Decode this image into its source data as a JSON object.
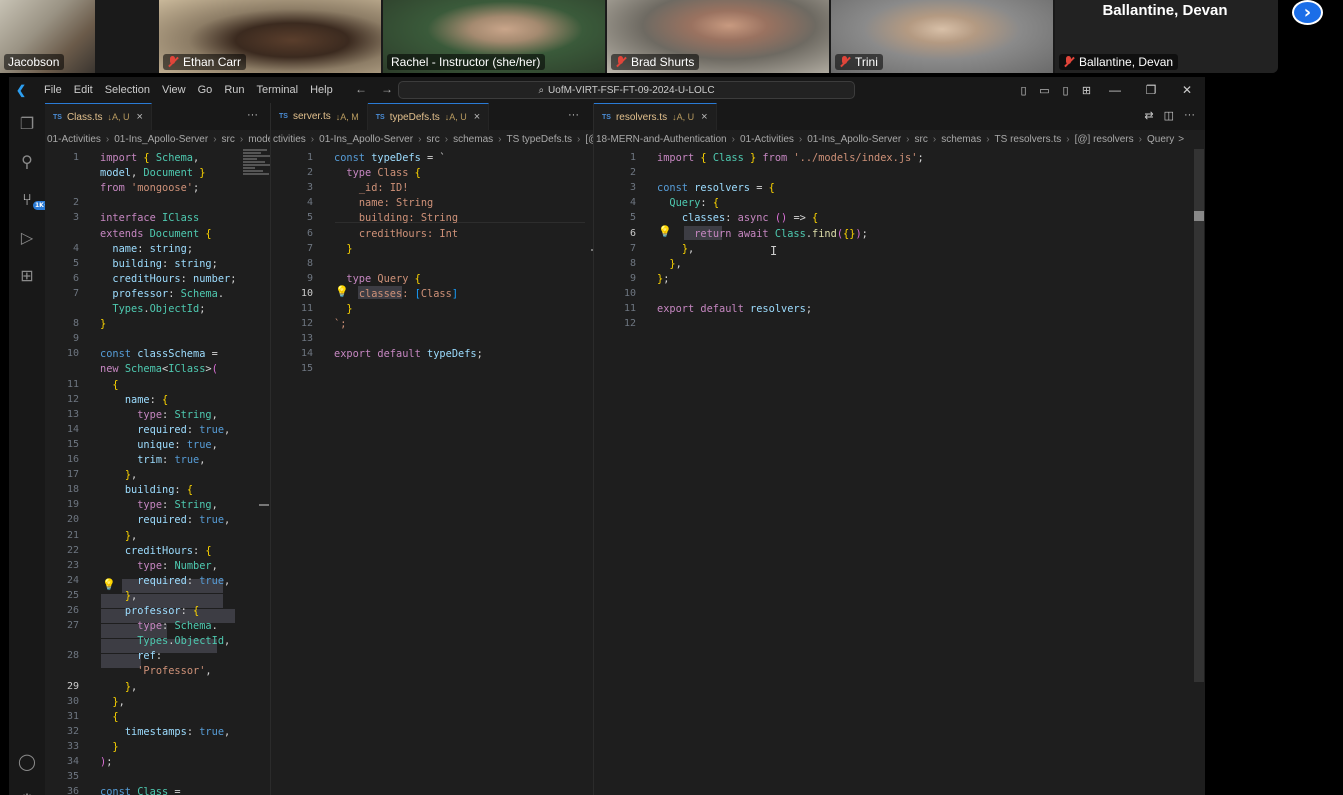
{
  "meeting": {
    "participants": [
      {
        "name": "Jacobson",
        "muted": false
      },
      {
        "name": "Ethan Carr",
        "muted": true
      },
      {
        "name": "Rachel - Instructor (she/her)",
        "muted": false,
        "speaking": true
      },
      {
        "name": "Brad Shurts",
        "muted": true
      },
      {
        "name": "Trini",
        "muted": true
      },
      {
        "name": "Ballantine, Devan",
        "muted": true
      }
    ],
    "featured_name": "Ballantine, Devan",
    "next_icon": "chevron-right-icon"
  },
  "vscode": {
    "menu": [
      "File",
      "Edit",
      "Selection",
      "View",
      "Go",
      "Run",
      "Terminal",
      "Help"
    ],
    "command_center": "UofM-VIRT-FSF-FT-09-2024-U-LOLC",
    "activity_badge": "1K+",
    "groups": [
      {
        "tabs": [
          {
            "lang": "TS",
            "name": "Class.ts",
            "status": "↓A, U",
            "active": true,
            "close": "×"
          }
        ],
        "breadcrumbs": [
          "01-Activities",
          "01-Ins_Apollo-Server",
          "src",
          "models"
        ]
      },
      {
        "tabs": [
          {
            "lang": "TS",
            "name": "server.ts",
            "status": "↓A, M",
            "active": false
          },
          {
            "lang": "TS",
            "name": "typeDefs.ts",
            "status": "↓A, U",
            "active": true,
            "close": "×"
          }
        ],
        "breadcrumbs": [
          "ctivities",
          "01-Ins_Apollo-Server",
          "src",
          "schemas",
          "TS typeDefs.ts",
          "[@]"
        ]
      },
      {
        "tabs": [
          {
            "lang": "TS",
            "name": "resolvers.ts",
            "status": "↓A, U",
            "active": true,
            "close": "×"
          }
        ],
        "breadcrumbs": [
          "18-MERN-and-Authentication",
          "01-Activities",
          "01-Ins_Apollo-Server",
          "src",
          "schemas",
          "TS resolvers.ts",
          "[@] resolvers",
          "Query",
          ">"
        ]
      }
    ],
    "code": {
      "class_ts": [
        {
          "n": "1",
          "t": "import { Schema,"
        },
        {
          "n": "",
          "t": "model, Document }"
        },
        {
          "n": "",
          "t": "from 'mongoose';"
        },
        {
          "n": "2",
          "t": ""
        },
        {
          "n": "3",
          "t": "interface IClass"
        },
        {
          "n": "",
          "t": "extends Document {"
        },
        {
          "n": "4",
          "t": "  name: string;"
        },
        {
          "n": "5",
          "t": "  building: string;"
        },
        {
          "n": "6",
          "t": "  creditHours: number;"
        },
        {
          "n": "7",
          "t": "  professor: Schema."
        },
        {
          "n": "",
          "t": "  Types.ObjectId;"
        },
        {
          "n": "8",
          "t": "}"
        },
        {
          "n": "9",
          "t": ""
        },
        {
          "n": "10",
          "t": "const classSchema ="
        },
        {
          "n": "",
          "t": "new Schema<IClass>("
        },
        {
          "n": "11",
          "t": "  {"
        },
        {
          "n": "12",
          "t": "    name: {"
        },
        {
          "n": "13",
          "t": "      type: String,"
        },
        {
          "n": "14",
          "t": "      required: true,"
        },
        {
          "n": "15",
          "t": "      unique: true,"
        },
        {
          "n": "16",
          "t": "      trim: true,"
        },
        {
          "n": "17",
          "t": "    },"
        },
        {
          "n": "18",
          "t": "    building: {"
        },
        {
          "n": "19",
          "t": "      type: String,"
        },
        {
          "n": "20",
          "t": "      required: true,"
        },
        {
          "n": "21",
          "t": "    },"
        },
        {
          "n": "22",
          "t": "    creditHours: {"
        },
        {
          "n": "23",
          "t": "      type: Number,"
        },
        {
          "n": "24",
          "t": "      required: true,"
        },
        {
          "n": "25",
          "t": "    },"
        },
        {
          "n": "26",
          "t": "    professor: {"
        },
        {
          "n": "27",
          "t": "      type: Schema."
        },
        {
          "n": "",
          "t": "      Types.ObjectId,"
        },
        {
          "n": "28",
          "t": "      ref:"
        },
        {
          "n": "",
          "t": "      'Professor',"
        },
        {
          "n": "29",
          "t": "    },"
        },
        {
          "n": "30",
          "t": "  },"
        },
        {
          "n": "31",
          "t": "  {"
        },
        {
          "n": "32",
          "t": "    timestamps: true,"
        },
        {
          "n": "33",
          "t": "  }"
        },
        {
          "n": "34",
          "t": ");"
        },
        {
          "n": "35",
          "t": ""
        },
        {
          "n": "36",
          "t": "const Class ="
        }
      ],
      "typedefs_ts": [
        {
          "n": "1",
          "t": "const typeDefs = `"
        },
        {
          "n": "2",
          "t": "  type Class {"
        },
        {
          "n": "3",
          "t": "    _id: ID!"
        },
        {
          "n": "4",
          "t": "    name: String"
        },
        {
          "n": "5",
          "t": "    building: String"
        },
        {
          "n": "6",
          "t": "    creditHours: Int"
        },
        {
          "n": "7",
          "t": "  }"
        },
        {
          "n": "8",
          "t": ""
        },
        {
          "n": "9",
          "t": "  type Query {"
        },
        {
          "n": "10",
          "t": "    classes: [Class]"
        },
        {
          "n": "11",
          "t": "  }"
        },
        {
          "n": "12",
          "t": "`;"
        },
        {
          "n": "13",
          "t": ""
        },
        {
          "n": "14",
          "t": "export default typeDefs;"
        },
        {
          "n": "15",
          "t": ""
        }
      ],
      "resolvers_ts": [
        {
          "n": "1",
          "t": "import { Class } from '../models/index.js';"
        },
        {
          "n": "2",
          "t": ""
        },
        {
          "n": "3",
          "t": "const resolvers = {"
        },
        {
          "n": "4",
          "t": "  Query: {"
        },
        {
          "n": "5",
          "t": "    classes: async () => {"
        },
        {
          "n": "6",
          "t": "      return await Class.find({});"
        },
        {
          "n": "7",
          "t": "    },"
        },
        {
          "n": "8",
          "t": "  },"
        },
        {
          "n": "9",
          "t": "};"
        },
        {
          "n": "10",
          "t": ""
        },
        {
          "n": "11",
          "t": "export default resolvers;"
        },
        {
          "n": "12",
          "t": ""
        }
      ]
    }
  }
}
